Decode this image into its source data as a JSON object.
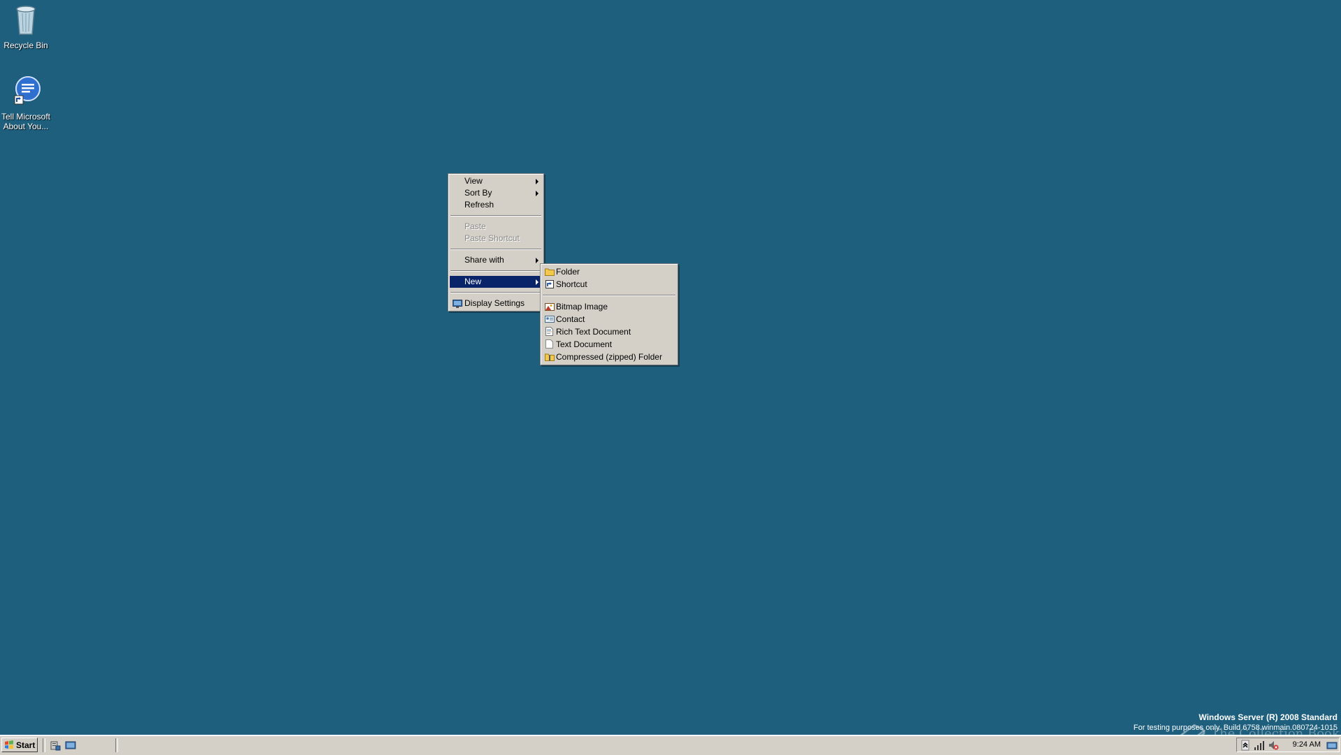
{
  "desktop": {
    "background_color": "#1e5f7d",
    "icons": [
      {
        "label": "Recycle Bin",
        "icon": "recycle-bin-icon"
      },
      {
        "label": "Tell Microsoft About You...",
        "icon": "feedback-icon"
      }
    ]
  },
  "context_menu": {
    "items": [
      {
        "label": "View",
        "has_submenu": true
      },
      {
        "label": "Sort By",
        "has_submenu": true
      },
      {
        "label": "Refresh"
      },
      {
        "label": "Paste",
        "disabled": true
      },
      {
        "label": "Paste Shortcut",
        "disabled": true
      },
      {
        "label": "Share with",
        "has_submenu": true
      },
      {
        "label": "New",
        "has_submenu": true,
        "selected": true
      },
      {
        "label": "Display Settings",
        "icon": "display-settings-icon"
      }
    ]
  },
  "new_submenu": {
    "items": [
      {
        "label": "Folder",
        "icon": "folder-icon"
      },
      {
        "label": "Shortcut",
        "icon": "shortcut-icon"
      },
      {
        "label": "Bitmap Image",
        "icon": "bitmap-icon"
      },
      {
        "label": "Contact",
        "icon": "contact-icon"
      },
      {
        "label": "Rich Text Document",
        "icon": "rtf-document-icon"
      },
      {
        "label": "Text Document",
        "icon": "text-document-icon"
      },
      {
        "label": "Compressed (zipped) Folder",
        "icon": "zip-folder-icon"
      }
    ]
  },
  "watermark": {
    "title": "Windows Server (R) 2008 Standard",
    "subtitle": "For testing purposes only. Build 6758.winmain.080724-1015"
  },
  "overlay_logo": {
    "text": "The Collection Book"
  },
  "taskbar": {
    "start_label": "Start",
    "clock": "9:24 AM"
  },
  "colors": {
    "menu_bg": "#d4d0c8",
    "selection": "#0a246a",
    "disabled_text": "#8a8a8a"
  }
}
